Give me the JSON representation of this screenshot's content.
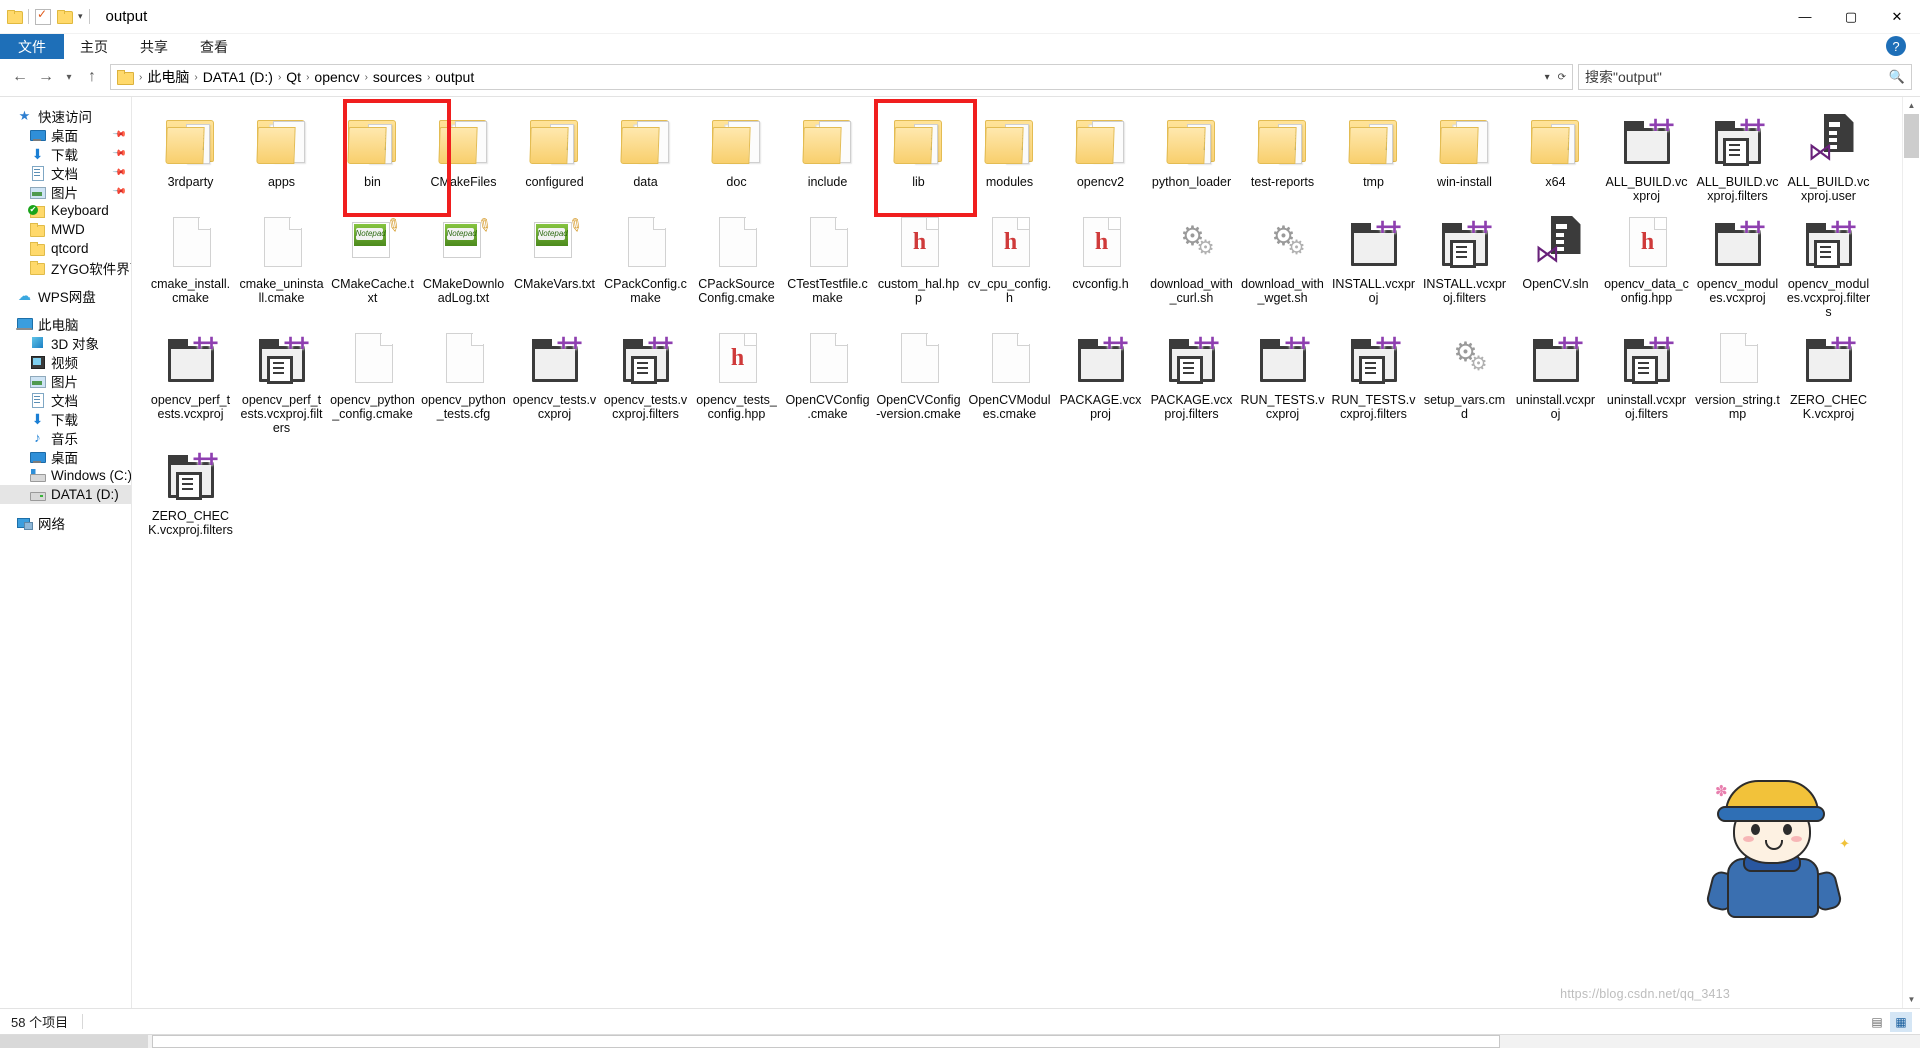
{
  "window": {
    "title": "output",
    "minimize": "—",
    "maximize": "▢",
    "close": "✕",
    "help": "?"
  },
  "quick_access_toolbar": {
    "folder_icon": "folder-icon",
    "properties_icon": "properties-icon",
    "new_folder_icon": "new-folder-icon",
    "dropdown": "▾"
  },
  "ribbon": {
    "tabs": [
      {
        "label": "文件",
        "active": true
      },
      {
        "label": "主页",
        "active": false
      },
      {
        "label": "共享",
        "active": false
      },
      {
        "label": "查看",
        "active": false
      }
    ]
  },
  "addressbar": {
    "back": "←",
    "forward": "→",
    "recent": "▾",
    "up": "↑",
    "crumbs": [
      "此电脑",
      "DATA1 (D:)",
      "Qt",
      "opencv",
      "sources",
      "output"
    ],
    "separator": "›",
    "dropdown": "▾",
    "refresh": "⟳",
    "search_value": "搜索\"output\"",
    "search_icon": "search-icon"
  },
  "navigation_pane": {
    "items": [
      {
        "label": "快速访问",
        "icon": "star-icon",
        "level": 1,
        "pinned": false,
        "selected": false,
        "icon_class": "star",
        "glyph": "★"
      },
      {
        "label": "桌面",
        "icon": "desktop-icon",
        "level": 2,
        "pinned": true,
        "selected": false,
        "icon_class": "desk",
        "glyph": ""
      },
      {
        "label": "下载",
        "icon": "downloads-icon",
        "level": 2,
        "pinned": true,
        "selected": false,
        "icon_class": "dl",
        "glyph": "⬇"
      },
      {
        "label": "文档",
        "icon": "documents-icon",
        "level": 2,
        "pinned": true,
        "selected": false,
        "icon_class": "doc",
        "glyph": ""
      },
      {
        "label": "图片",
        "icon": "pictures-icon",
        "level": 2,
        "pinned": true,
        "selected": false,
        "icon_class": "pic",
        "glyph": ""
      },
      {
        "label": "Keyboard",
        "icon": "synced-folder-icon",
        "level": 2,
        "pinned": false,
        "selected": false,
        "icon_class": "greenfold",
        "glyph": ""
      },
      {
        "label": "MWD",
        "icon": "folder-icon",
        "level": 2,
        "pinned": false,
        "selected": false,
        "icon_class": "fold",
        "glyph": ""
      },
      {
        "label": "qtcord",
        "icon": "folder-icon",
        "level": 2,
        "pinned": false,
        "selected": false,
        "icon_class": "fold",
        "glyph": ""
      },
      {
        "label": "ZYGO软件界面",
        "icon": "folder-icon",
        "level": 2,
        "pinned": false,
        "selected": false,
        "icon_class": "fold",
        "glyph": ""
      },
      {
        "label": "WPS网盘",
        "icon": "cloud-icon",
        "level": 1,
        "pinned": false,
        "selected": false,
        "icon_class": "cloud",
        "glyph": "☁",
        "gap_before": true
      },
      {
        "label": "此电脑",
        "icon": "this-pc-icon",
        "level": 1,
        "pinned": false,
        "selected": false,
        "icon_class": "pc",
        "glyph": "",
        "gap_before": true
      },
      {
        "label": "3D 对象",
        "icon": "3d-objects-icon",
        "level": 2,
        "pinned": false,
        "selected": false,
        "icon_class": "cube",
        "glyph": ""
      },
      {
        "label": "视频",
        "icon": "videos-icon",
        "level": 2,
        "pinned": false,
        "selected": false,
        "icon_class": "vid",
        "glyph": ""
      },
      {
        "label": "图片",
        "icon": "pictures-icon",
        "level": 2,
        "pinned": false,
        "selected": false,
        "icon_class": "pic",
        "glyph": ""
      },
      {
        "label": "文档",
        "icon": "documents-icon",
        "level": 2,
        "pinned": false,
        "selected": false,
        "icon_class": "doc",
        "glyph": ""
      },
      {
        "label": "下载",
        "icon": "downloads-icon",
        "level": 2,
        "pinned": false,
        "selected": false,
        "icon_class": "dl",
        "glyph": "⬇"
      },
      {
        "label": "音乐",
        "icon": "music-icon",
        "level": 2,
        "pinned": false,
        "selected": false,
        "icon_class": "mus",
        "glyph": "♪"
      },
      {
        "label": "桌面",
        "icon": "desktop-icon",
        "level": 2,
        "pinned": false,
        "selected": false,
        "icon_class": "desk",
        "glyph": ""
      },
      {
        "label": "Windows (C:)",
        "icon": "local-disk-icon",
        "level": 2,
        "pinned": false,
        "selected": false,
        "icon_class": "drvc",
        "glyph": ""
      },
      {
        "label": "DATA1 (D:)",
        "icon": "local-disk-icon",
        "level": 2,
        "pinned": false,
        "selected": true,
        "icon_class": "drv",
        "glyph": ""
      },
      {
        "label": "网络",
        "icon": "network-icon",
        "level": 1,
        "pinned": false,
        "selected": false,
        "icon_class": "net",
        "glyph": "",
        "gap_before": true
      }
    ]
  },
  "files": [
    {
      "name": "3rdparty",
      "type": "folder"
    },
    {
      "name": "apps",
      "type": "folder-empty"
    },
    {
      "name": "bin",
      "type": "folder",
      "highlighted": true
    },
    {
      "name": "CMakeFiles",
      "type": "folder-empty"
    },
    {
      "name": "configured",
      "type": "folder"
    },
    {
      "name": "data",
      "type": "folder-empty"
    },
    {
      "name": "doc",
      "type": "folder-empty"
    },
    {
      "name": "include",
      "type": "folder-empty"
    },
    {
      "name": "lib",
      "type": "folder",
      "highlighted": true
    },
    {
      "name": "modules",
      "type": "folder"
    },
    {
      "name": "opencv2",
      "type": "folder-empty"
    },
    {
      "name": "python_loader",
      "type": "folder"
    },
    {
      "name": "test-reports",
      "type": "folder"
    },
    {
      "name": "tmp",
      "type": "folder"
    },
    {
      "name": "win-install",
      "type": "folder-empty"
    },
    {
      "name": "x64",
      "type": "folder"
    },
    {
      "name": "ALL_BUILD.vcxproj",
      "type": "vcxproj"
    },
    {
      "name": "ALL_BUILD.vcxproj.filters",
      "type": "vcxproj-filters"
    },
    {
      "name": "ALL_BUILD.vcxproj.user",
      "type": "sln"
    },
    {
      "name": "cmake_install.cmake",
      "type": "doc"
    },
    {
      "name": "cmake_uninstall.cmake",
      "type": "doc"
    },
    {
      "name": "CMakeCache.txt",
      "type": "notepad"
    },
    {
      "name": "CMakeDownloadLog.txt",
      "type": "notepad"
    },
    {
      "name": "CMakeVars.txt",
      "type": "notepad"
    },
    {
      "name": "CPackConfig.cmake",
      "type": "doc"
    },
    {
      "name": "CPackSourceConfig.cmake",
      "type": "doc"
    },
    {
      "name": "CTestTestfile.cmake",
      "type": "doc"
    },
    {
      "name": "custom_hal.hpp",
      "type": "header"
    },
    {
      "name": "cv_cpu_config.h",
      "type": "header"
    },
    {
      "name": "cvconfig.h",
      "type": "header"
    },
    {
      "name": "download_with_curl.sh",
      "type": "gear"
    },
    {
      "name": "download_with_wget.sh",
      "type": "gear"
    },
    {
      "name": "INSTALL.vcxproj",
      "type": "vcxproj"
    },
    {
      "name": "INSTALL.vcxproj.filters",
      "type": "vcxproj-filters"
    },
    {
      "name": "OpenCV.sln",
      "type": "sln"
    },
    {
      "name": "opencv_data_config.hpp",
      "type": "header"
    },
    {
      "name": "opencv_modules.vcxproj",
      "type": "vcxproj"
    },
    {
      "name": "opencv_modules.vcxproj.filters",
      "type": "vcxproj-filters"
    },
    {
      "name": "opencv_perf_tests.vcxproj",
      "type": "vcxproj"
    },
    {
      "name": "opencv_perf_tests.vcxproj.filters",
      "type": "vcxproj-filters"
    },
    {
      "name": "opencv_python_config.cmake",
      "type": "doc"
    },
    {
      "name": "opencv_python_tests.cfg",
      "type": "doc"
    },
    {
      "name": "opencv_tests.vcxproj",
      "type": "vcxproj"
    },
    {
      "name": "opencv_tests.vcxproj.filters",
      "type": "vcxproj-filters"
    },
    {
      "name": "opencv_tests_config.hpp",
      "type": "header"
    },
    {
      "name": "OpenCVConfig.cmake",
      "type": "doc"
    },
    {
      "name": "OpenCVConfig-version.cmake",
      "type": "doc"
    },
    {
      "name": "OpenCVModules.cmake",
      "type": "doc"
    },
    {
      "name": "PACKAGE.vcxproj",
      "type": "vcxproj"
    },
    {
      "name": "PACKAGE.vcxproj.filters",
      "type": "vcxproj-filters"
    },
    {
      "name": "RUN_TESTS.vcxproj",
      "type": "vcxproj"
    },
    {
      "name": "RUN_TESTS.vcxproj.filters",
      "type": "vcxproj-filters"
    },
    {
      "name": "setup_vars.cmd",
      "type": "gear"
    },
    {
      "name": "uninstall.vcxproj",
      "type": "vcxproj"
    },
    {
      "name": "uninstall.vcxproj.filters",
      "type": "vcxproj-filters"
    },
    {
      "name": "version_string.tmp",
      "type": "doc"
    },
    {
      "name": "ZERO_CHECK.vcxproj",
      "type": "vcxproj"
    },
    {
      "name": "ZERO_CHECK.vcxproj.filters",
      "type": "vcxproj-filters"
    }
  ],
  "status_bar": {
    "item_count": "58 个项目",
    "view_details_icon": "details-view-icon",
    "view_large_icons_icon": "large-icons-view-icon"
  },
  "watermark": "https://blog.csdn.net/qq_3413",
  "colors": {
    "highlight_red": "#f01e1e",
    "accent_blue": "#1e6fb8",
    "folder_yellow": "#ffd96b",
    "selection_grey": "#e5e5e5"
  },
  "mascot": {
    "name": "csdn-mascot",
    "buttons": [
      "⚙",
      "↑",
      "✉"
    ]
  }
}
